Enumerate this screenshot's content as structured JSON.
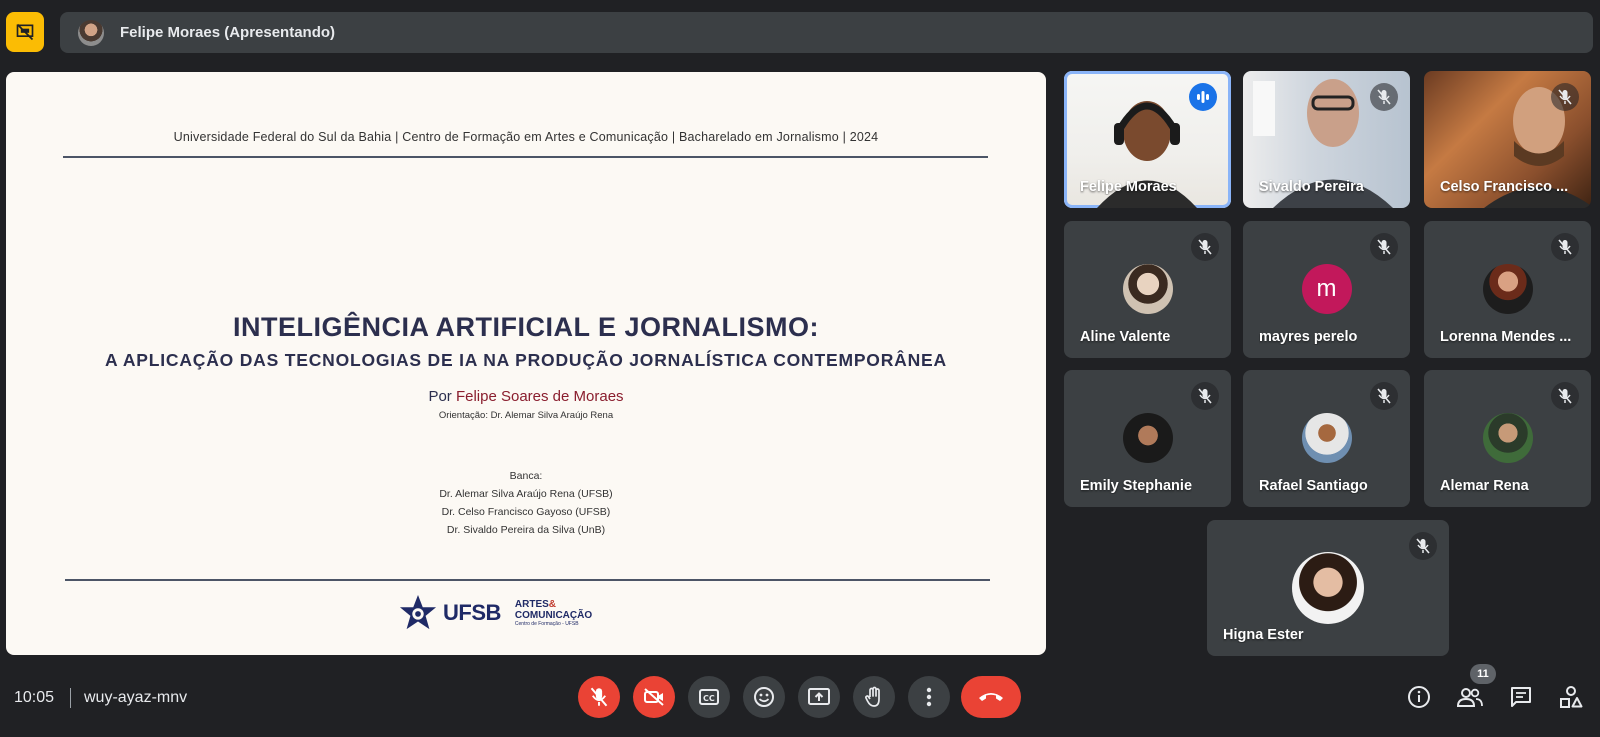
{
  "top_bar": {
    "presenter_label": "Felipe Moraes (Apresentando)",
    "presenting_icon": "stop-presenting-icon"
  },
  "slide": {
    "header": "Universidade Federal do Sul da Bahia | Centro de Formação em Artes e Comunicação | Bacharelado em Jornalismo | 2024",
    "title": "INTELIGÊNCIA ARTIFICIAL E JORNALISMO:",
    "subtitle": "A APLICAÇÃO DAS TECNOLOGIAS DE IA NA PRODUÇÃO JORNALÍSTICA CONTEMPORÂNEA",
    "by_prefix": "Por ",
    "author": "Felipe Soares de Moraes",
    "advisor": "Orientação: Dr. Alemar Silva Araújo Rena",
    "banca_title": "Banca:",
    "banca_members": [
      "Dr. Alemar Silva Araújo Rena (UFSB)",
      "Dr. Celso Francisco Gayoso (UFSB)",
      "Dr. Sivaldo Pereira da Silva (UnB)"
    ],
    "logo_ufsb": "UFSB",
    "logo_artes_1": "ARTES",
    "logo_artes_2": "COMUNICAÇÃO",
    "logo_artes_small": "Centro de Formação - UFSB",
    "logo_artes_amp": "&"
  },
  "participants": [
    {
      "name": "Felipe Moraes",
      "state": "speaking",
      "video": true
    },
    {
      "name": "Sivaldo Pereira",
      "state": "muted",
      "video": true
    },
    {
      "name": "Celso Francisco ...",
      "state": "muted",
      "video": true
    },
    {
      "name": "Aline Valente",
      "state": "muted",
      "video": false
    },
    {
      "name": "mayres perelo",
      "state": "muted",
      "video": false,
      "initial": "m",
      "avatar_color": "#c2185b"
    },
    {
      "name": "Lorenna Mendes ...",
      "state": "muted",
      "video": false
    },
    {
      "name": "Emily Stephanie",
      "state": "muted",
      "video": false
    },
    {
      "name": "Rafael Santiago",
      "state": "muted",
      "video": false
    },
    {
      "name": "Alemar Rena",
      "state": "muted",
      "video": false
    },
    {
      "name": "Higna Ester",
      "state": "muted",
      "video": false
    }
  ],
  "bottom_bar": {
    "time": "10:05",
    "meeting_code": "wuy-ayaz-mnv",
    "controls": [
      "mic-off-icon",
      "camera-off-icon",
      "captions-icon",
      "emoji-icon",
      "present-screen-icon",
      "raise-hand-icon",
      "more-options-icon",
      "end-call-icon"
    ],
    "right_controls": [
      "info-icon",
      "people-icon",
      "chat-icon",
      "activities-icon"
    ],
    "people_count": "11"
  },
  "colors": {
    "background": "#202124",
    "tile": "#3c4043",
    "accent_yellow": "#fbbc04",
    "danger": "#ea4335",
    "speaking_blue": "#1a73e8"
  }
}
